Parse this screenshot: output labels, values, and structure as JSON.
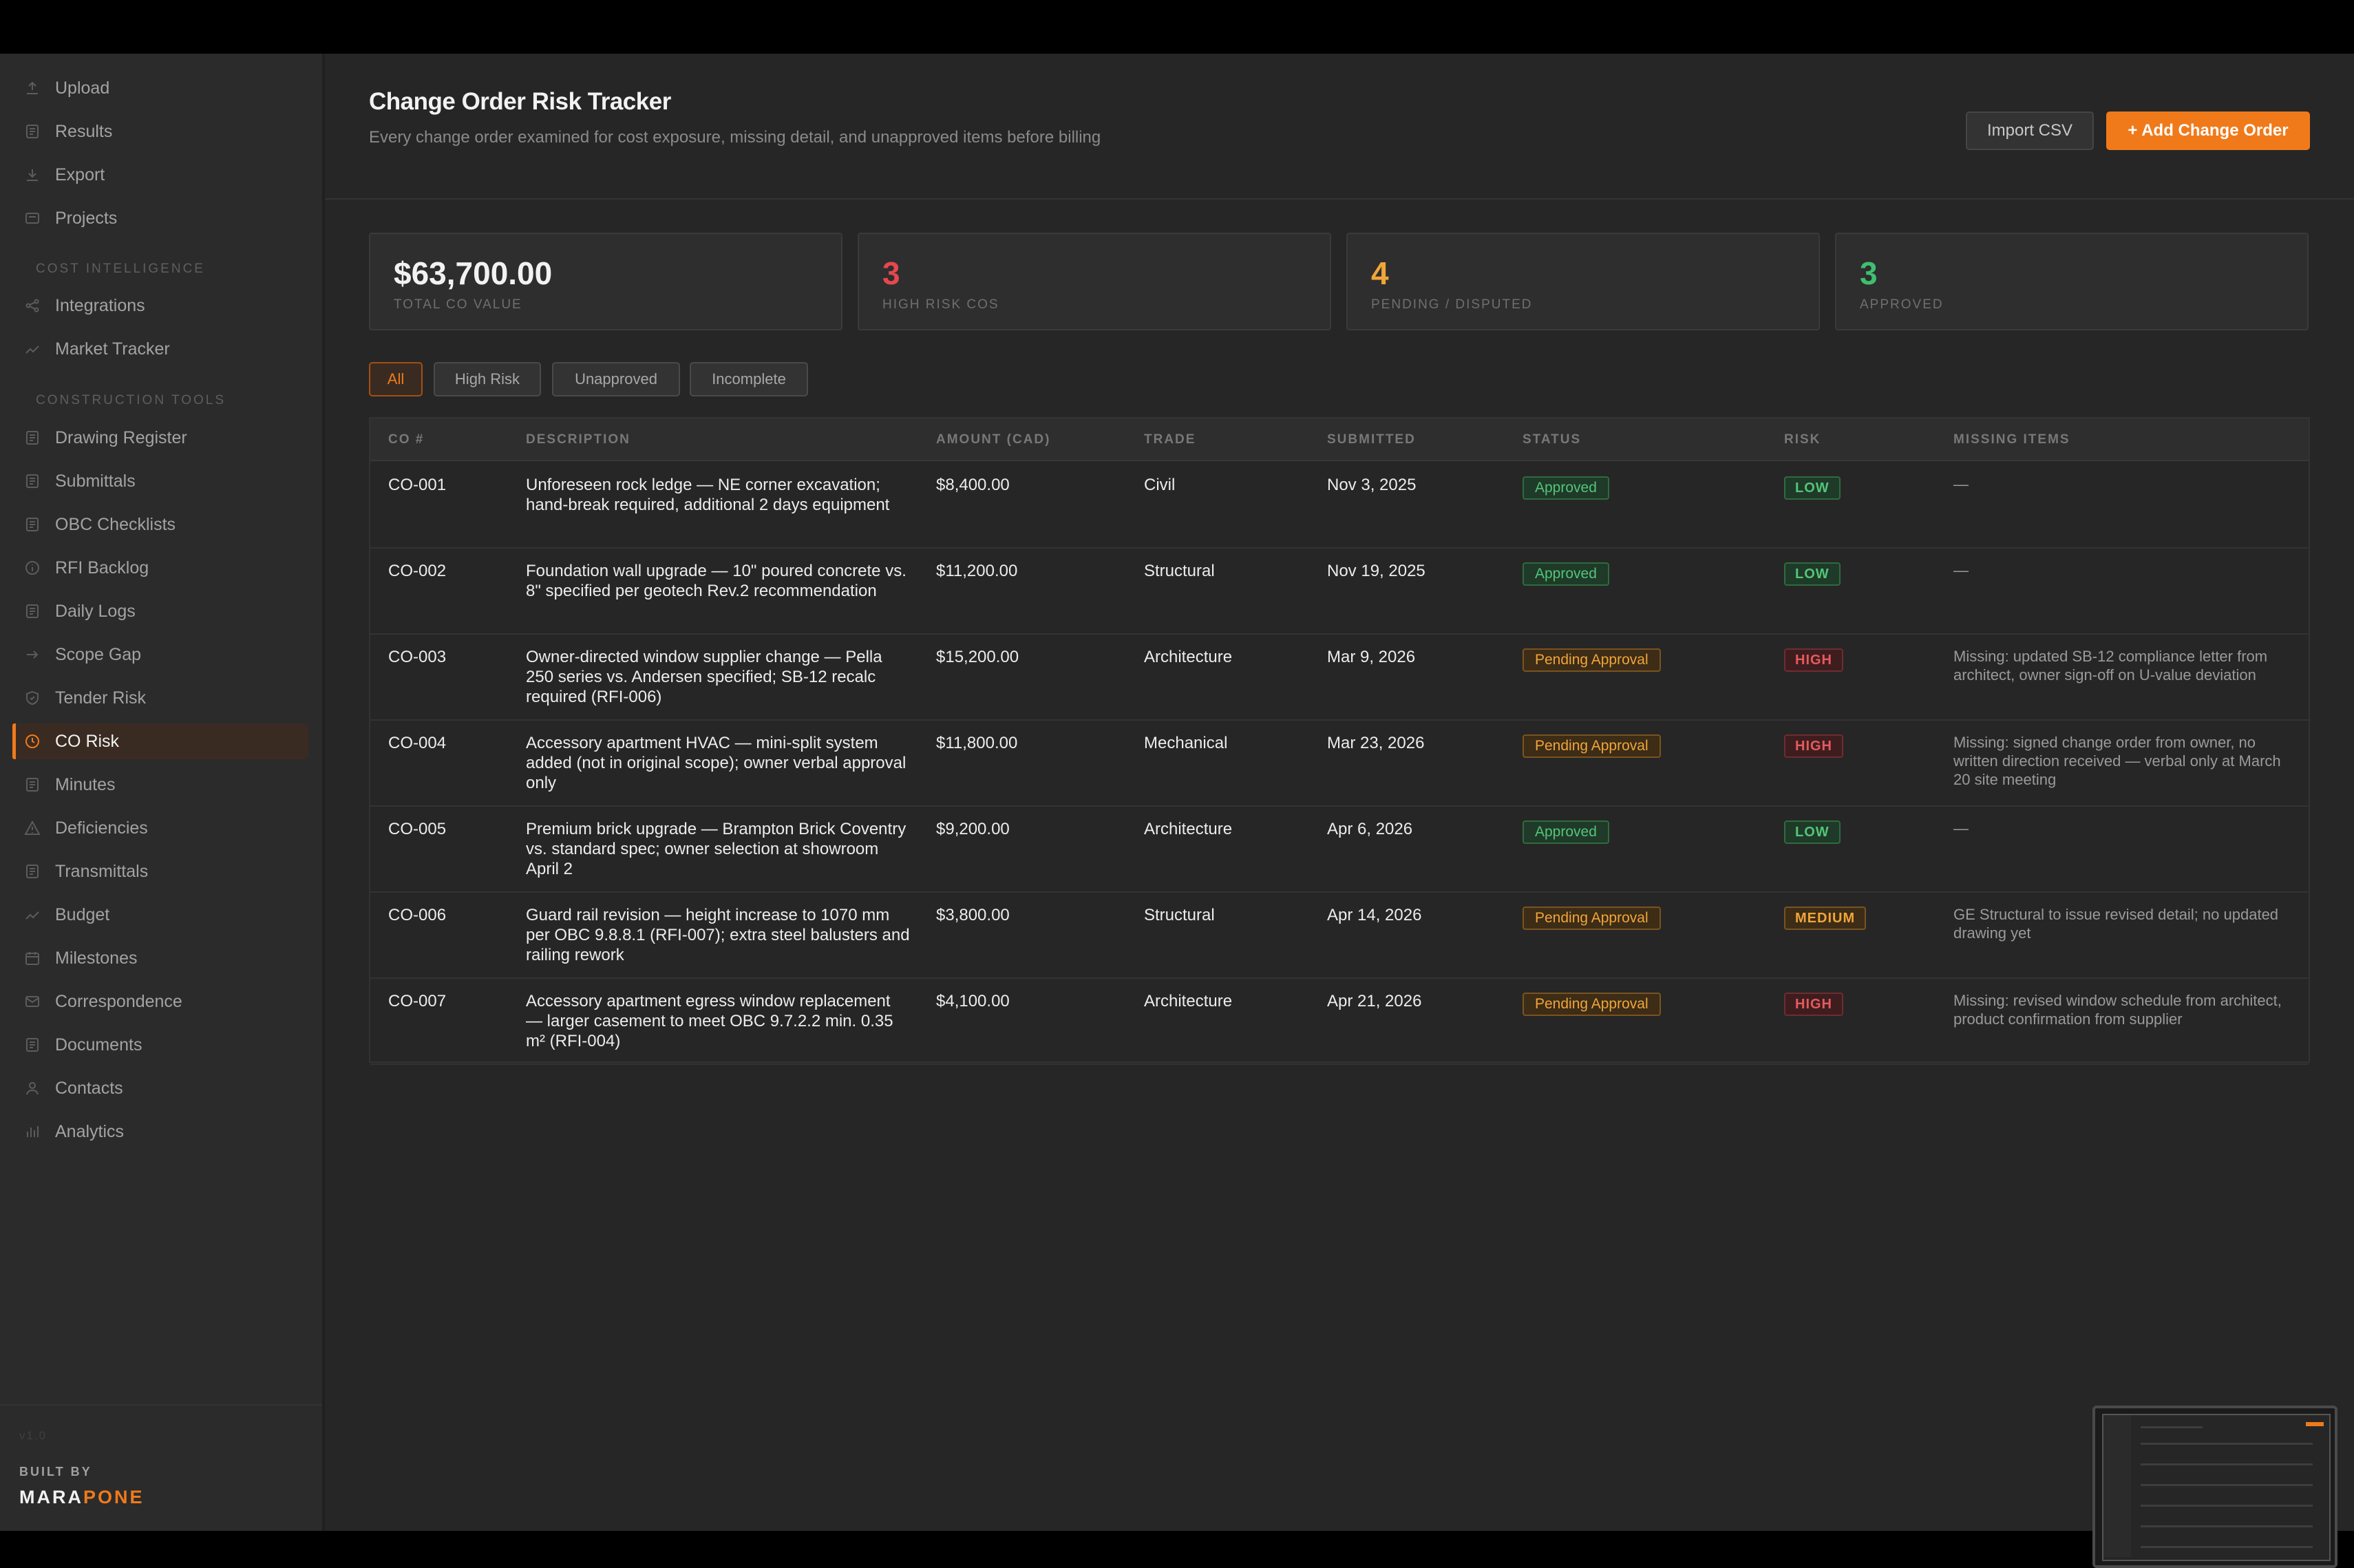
{
  "sidebar": {
    "items_top": [
      {
        "label": "Upload",
        "icon": "upload-icon"
      },
      {
        "label": "Results",
        "icon": "document-icon"
      },
      {
        "label": "Export",
        "icon": "download-icon"
      },
      {
        "label": "Projects",
        "icon": "folder-icon"
      }
    ],
    "section_cost": "COST INTELLIGENCE",
    "items_cost": [
      {
        "label": "Integrations",
        "icon": "share-icon"
      },
      {
        "label": "Market Tracker",
        "icon": "trend-icon"
      }
    ],
    "section_tools": "CONSTRUCTION TOOLS",
    "items_tools": [
      {
        "label": "Drawing Register",
        "icon": "document-icon"
      },
      {
        "label": "Submittals",
        "icon": "document-icon"
      },
      {
        "label": "OBC Checklists",
        "icon": "document-icon"
      },
      {
        "label": "RFI Backlog",
        "icon": "info-icon"
      },
      {
        "label": "Daily Logs",
        "icon": "document-icon"
      },
      {
        "label": "Scope Gap",
        "icon": "arrow-icon"
      },
      {
        "label": "Tender Risk",
        "icon": "shield-icon"
      },
      {
        "label": "CO Risk",
        "icon": "clock-icon",
        "active": true
      },
      {
        "label": "Minutes",
        "icon": "document-icon"
      },
      {
        "label": "Deficiencies",
        "icon": "warning-icon"
      },
      {
        "label": "Transmittals",
        "icon": "document-icon"
      },
      {
        "label": "Budget",
        "icon": "trend-icon"
      },
      {
        "label": "Milestones",
        "icon": "calendar-icon"
      },
      {
        "label": "Correspondence",
        "icon": "mail-icon"
      },
      {
        "label": "Documents",
        "icon": "document-icon"
      },
      {
        "label": "Contacts",
        "icon": "person-icon"
      },
      {
        "label": "Analytics",
        "icon": "bar-chart-icon"
      }
    ],
    "version": "v1.0",
    "built_by": "BUILT BY",
    "brand_a": "MARA",
    "brand_b": "PONE"
  },
  "header": {
    "title": "Change Order Risk Tracker",
    "subtitle": "Every change order examined for cost exposure, missing detail, and unapproved items before billing",
    "import_label": "Import CSV",
    "add_label": "+ Add Change Order"
  },
  "stats": [
    {
      "value": "$63,700.00",
      "caption": "TOTAL CO VALUE",
      "color": "#f2f2f2"
    },
    {
      "value": "3",
      "caption": "HIGH RISK COS",
      "color": "#e5484d"
    },
    {
      "value": "4",
      "caption": "PENDING / DISPUTED",
      "color": "#f0a53a"
    },
    {
      "value": "3",
      "caption": "APPROVED",
      "color": "#3fbf6f"
    }
  ],
  "filters": [
    "All",
    "High Risk",
    "Unapproved",
    "Incomplete"
  ],
  "columns": [
    "CO #",
    "DESCRIPTION",
    "AMOUNT (CAD)",
    "TRADE",
    "SUBMITTED",
    "STATUS",
    "RISK",
    "MISSING ITEMS"
  ],
  "rows": [
    {
      "co": "CO-001",
      "desc": "Unforeseen rock ledge — NE corner excavation; hand-break required, additional 2 days equipment",
      "amount": "$8,400.00",
      "trade": "Civil",
      "submitted": "Nov 3, 2025",
      "status": "Approved",
      "risk": "LOW",
      "missing": "—"
    },
    {
      "co": "CO-002",
      "desc": "Foundation wall upgrade — 10\" poured concrete vs. 8\" specified per geotech Rev.2 recommendation",
      "amount": "$11,200.00",
      "trade": "Structural",
      "submitted": "Nov 19, 2025",
      "status": "Approved",
      "risk": "LOW",
      "missing": "—"
    },
    {
      "co": "CO-003",
      "desc": "Owner-directed window supplier change — Pella 250 series vs. Andersen specified; SB-12 recalc required (RFI-006)",
      "amount": "$15,200.00",
      "trade": "Architecture",
      "submitted": "Mar 9, 2026",
      "status": "Pending Approval",
      "risk": "HIGH",
      "missing": "Missing: updated SB-12 compliance letter from architect, owner sign-off on U-value deviation"
    },
    {
      "co": "CO-004",
      "desc": "Accessory apartment HVAC — mini-split system added (not in original scope); owner verbal approval only",
      "amount": "$11,800.00",
      "trade": "Mechanical",
      "submitted": "Mar 23, 2026",
      "status": "Pending Approval",
      "risk": "HIGH",
      "missing": "Missing: signed change order from owner, no written direction received — verbal only at March 20 site meeting"
    },
    {
      "co": "CO-005",
      "desc": "Premium brick upgrade — Brampton Brick Coventry vs. standard spec; owner selection at showroom April 2",
      "amount": "$9,200.00",
      "trade": "Architecture",
      "submitted": "Apr 6, 2026",
      "status": "Approved",
      "risk": "LOW",
      "missing": "—"
    },
    {
      "co": "CO-006",
      "desc": "Guard rail revision — height increase to 1070 mm per OBC 9.8.8.1 (RFI-007); extra steel balusters and railing rework",
      "amount": "$3,800.00",
      "trade": "Structural",
      "submitted": "Apr 14, 2026",
      "status": "Pending Approval",
      "risk": "MEDIUM",
      "missing": "GE Structural to issue revised detail; no updated drawing yet"
    },
    {
      "co": "CO-007",
      "desc": "Accessory apartment egress window replacement — larger casement to meet OBC 9.7.2.2 min. 0.35 m² (RFI-004)",
      "amount": "$4,100.00",
      "trade": "Architecture",
      "submitted": "Apr 21, 2026",
      "status": "Pending Approval",
      "risk": "HIGH",
      "missing": "Missing: revised window schedule from architect, product confirmation from supplier"
    }
  ]
}
